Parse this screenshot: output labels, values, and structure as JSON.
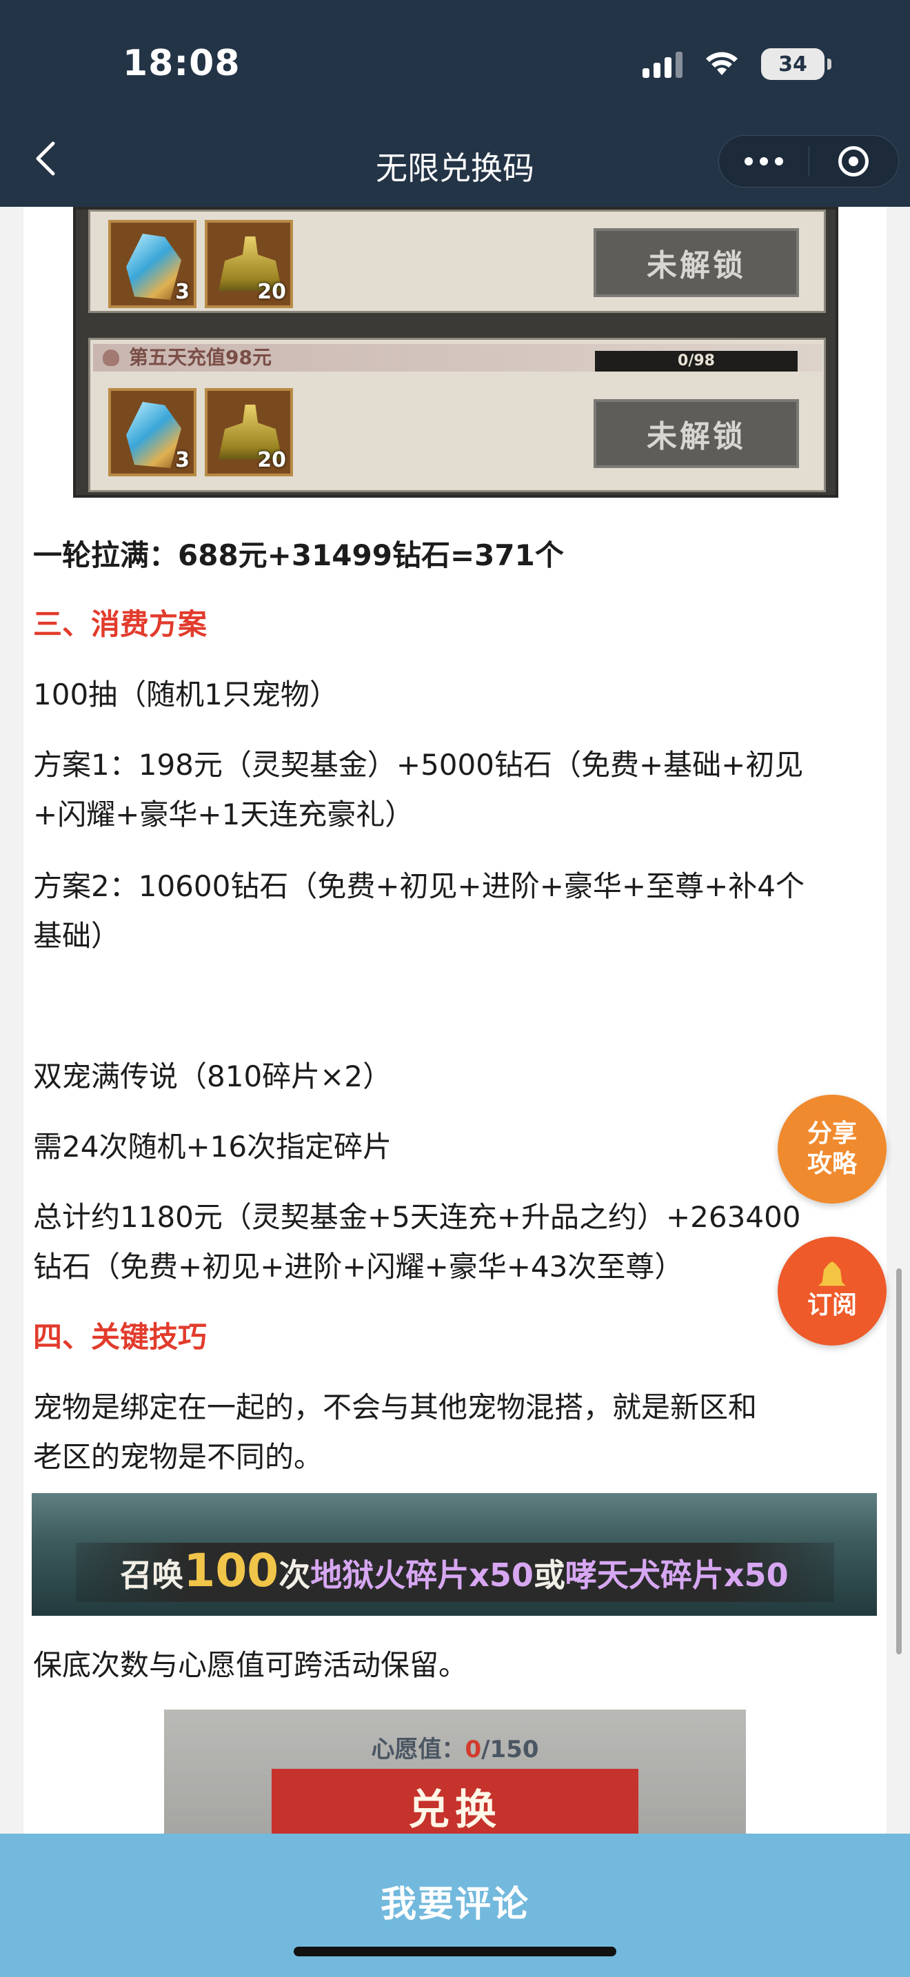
{
  "status_bar": {
    "time": "18:08",
    "battery": "34"
  },
  "nav": {
    "title": "无限兑换码",
    "back_icon": "chevron-left-icon",
    "more_icon": "more-dots-icon",
    "target_icon": "target-icon"
  },
  "game_image": {
    "row1": {
      "item1_count": "3",
      "item2_count": "20",
      "button": "未解锁"
    },
    "row2": {
      "title": "第五天充值98元",
      "progress": "0/98",
      "item1_count": "3",
      "item2_count": "20",
      "button": "未解锁"
    }
  },
  "article": {
    "summary": "一轮拉满：688元+31499钻石=371个",
    "section3_title": "三、消费方案",
    "p1": "100抽（随机1只宠物）",
    "p2_line1": "方案1：198元（灵契基金）+5000钻石（免费+基础+初见",
    "p2_line2": "+闪耀+豪华+1天连充豪礼）",
    "p3_line1": "方案2：10600钻石（免费+初见+进阶+豪华+至尊+补4个",
    "p3_line2": "基础）",
    "p4": "双宠满传说（810碎片×2）",
    "p5": "需24次随机+16次指定碎片",
    "p6_line1": "总计约1180元（灵契基金+5天连充+升品之约）+263400",
    "p6_line2": "钻石（免费+初见+进阶+闪耀+豪华+43次至尊）",
    "section4_title": "四、关键技巧",
    "p7_line1": "宠物是绑定在一起的，不会与其他宠物混搭，就是新区和",
    "p7_line2": "老区的宠物是不同的。",
    "p8": "保底次数与心愿值可跨活动保留。"
  },
  "banner": {
    "prefix": "召唤",
    "count": "100",
    "suffix": "次",
    "item1": "地狱火碎片x50",
    "or": "或",
    "item2": "哮天犬碎片x50"
  },
  "wish_image": {
    "label": "心愿值：",
    "current": "0",
    "max": "/150",
    "button": "兑换"
  },
  "floating": {
    "share_line1": "分享",
    "share_line2": "攻略",
    "subscribe": "订阅",
    "bell_icon": "bell-icon"
  },
  "comment_bar": {
    "label": "我要评论"
  },
  "colors": {
    "header_bg": "#243447",
    "accent_red": "#e23b2c",
    "float_orange": "#f08a2e",
    "comment_bar": "#73b9dd"
  }
}
